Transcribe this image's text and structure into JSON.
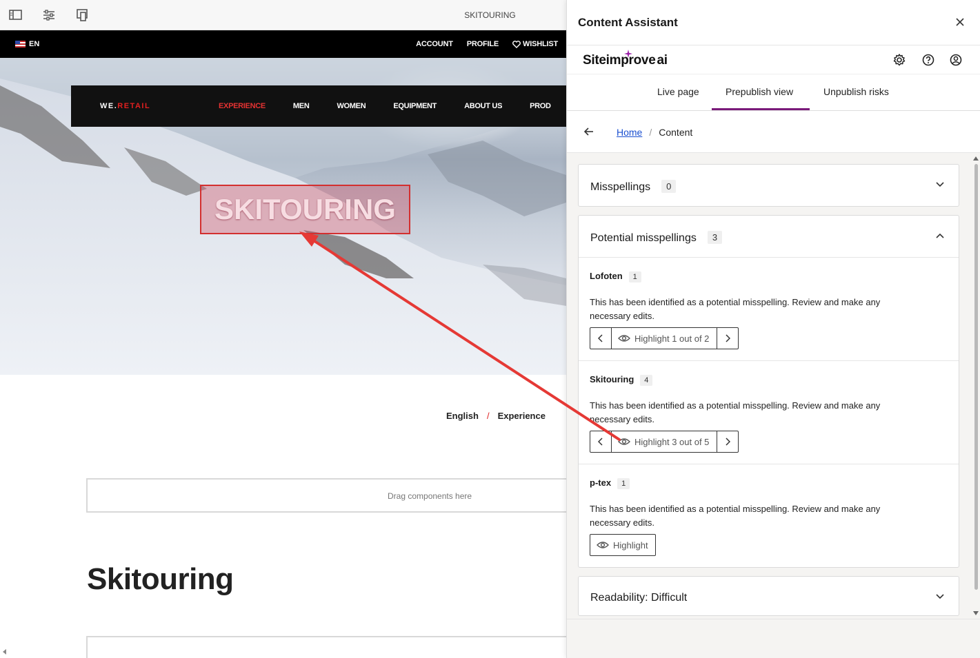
{
  "editor": {
    "page_title": "SKITOURING",
    "site": {
      "language": "EN",
      "top_links": [
        "ACCOUNT",
        "PROFILE",
        "WISHLIST"
      ],
      "brand_prefix": "WE.",
      "brand_suffix": "RETAIL",
      "nav": [
        "EXPERIENCE",
        "MEN",
        "WOMEN",
        "EQUIPMENT",
        "ABOUT US",
        "PROD"
      ],
      "hero_title": "SKITOURING",
      "breadcrumb": [
        "English",
        "/",
        "Experience"
      ],
      "drop_zone_label": "Drag components here",
      "page_heading": "Skitouring"
    }
  },
  "panel": {
    "title": "Content Assistant",
    "logo_text": "Siteimprove",
    "logo_ai": "ai",
    "tabs": [
      "Live page",
      "Prepublish view",
      "Unpublish risks"
    ],
    "active_tab": "Prepublish view",
    "breadcrumb": {
      "home": "Home",
      "sep": "/",
      "current": "Content"
    },
    "sections": {
      "misspellings": {
        "label": "Misspellings",
        "count": "0"
      },
      "potential": {
        "label": "Potential misspellings",
        "count": "3",
        "items": [
          {
            "word": "Lofoten",
            "count": "1",
            "desc": "This has been identified as a potential misspelling. Review and make any necessary edits.",
            "highlight": "Highlight 1 out of 2"
          },
          {
            "word": "Skitouring",
            "count": "4",
            "desc": "This has been identified as a potential misspelling. Review and make any necessary edits.",
            "highlight": "Highlight 3 out of 5"
          },
          {
            "word": "p-tex",
            "count": "1",
            "desc": "This has been identified as a potential misspelling. Review and make any necessary edits.",
            "highlight": "Highlight"
          }
        ]
      },
      "readability": {
        "label": "Readability: Difficult"
      }
    }
  },
  "colors": {
    "accent": "#7a1a7a",
    "nav_active": "#e43232",
    "link": "#1a4fd0",
    "annotation_arrow": "#e53935"
  }
}
